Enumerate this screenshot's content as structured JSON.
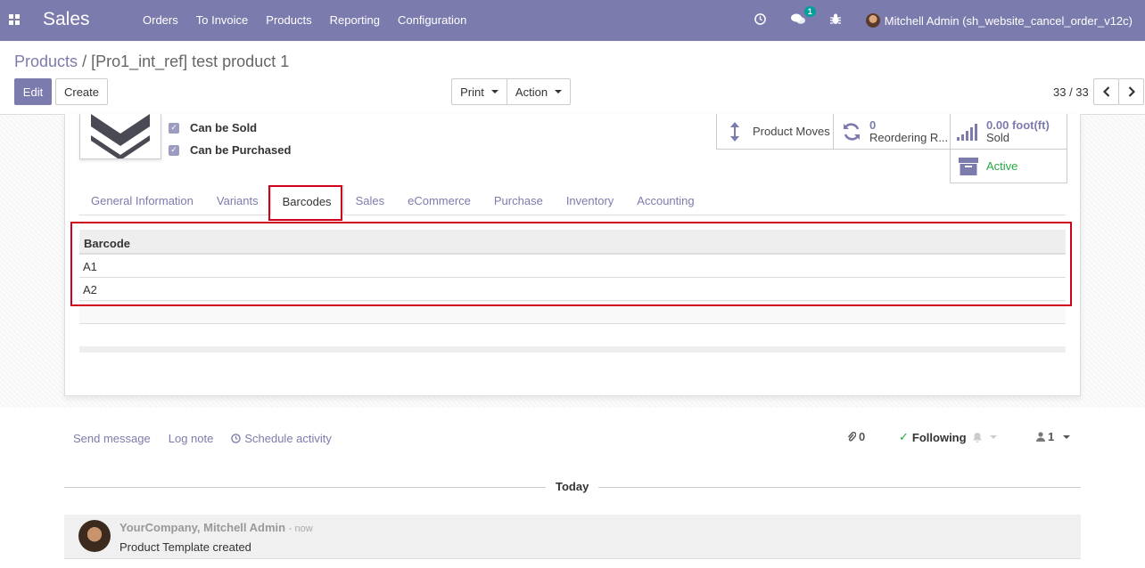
{
  "navbar": {
    "brand": "Sales",
    "menu": [
      "Orders",
      "To Invoice",
      "Products",
      "Reporting",
      "Configuration"
    ],
    "messages_badge": "1",
    "user": "Mitchell Admin (sh_website_cancel_order_v12c)"
  },
  "breadcrumb": {
    "parent": "Products",
    "separator": "/",
    "current": "[Pro1_int_ref] test product 1"
  },
  "buttons": {
    "edit": "Edit",
    "create": "Create",
    "print": "Print",
    "action": "Action"
  },
  "pager": {
    "value": "33 / 33"
  },
  "product": {
    "can_be_sold": "Can be Sold",
    "can_be_purchased": "Can be Purchased"
  },
  "stats": {
    "product_moves": "Product Moves",
    "reordering_count": "0",
    "reordering_label": "Reordering R...",
    "sold_value": "0.00",
    "sold_unit": "foot(ft)",
    "sold_label": "Sold",
    "active": "Active"
  },
  "tabs": [
    "General Information",
    "Variants",
    "Barcodes",
    "Sales",
    "eCommerce",
    "Purchase",
    "Inventory",
    "Accounting"
  ],
  "barcodes": {
    "header": "Barcode",
    "rows": [
      "A1",
      "A2"
    ]
  },
  "chatter": {
    "send_message": "Send message",
    "log_note": "Log note",
    "schedule_activity": "Schedule activity",
    "attachments": "0",
    "following": "Following",
    "followers": "1",
    "today": "Today",
    "message": {
      "author": "YourCompany, Mitchell Admin",
      "time": "now",
      "body": "Product Template created"
    }
  },
  "colors": {
    "navbar": "#7c7bad",
    "highlight": "#d0021b",
    "active_green": "#28a745"
  }
}
